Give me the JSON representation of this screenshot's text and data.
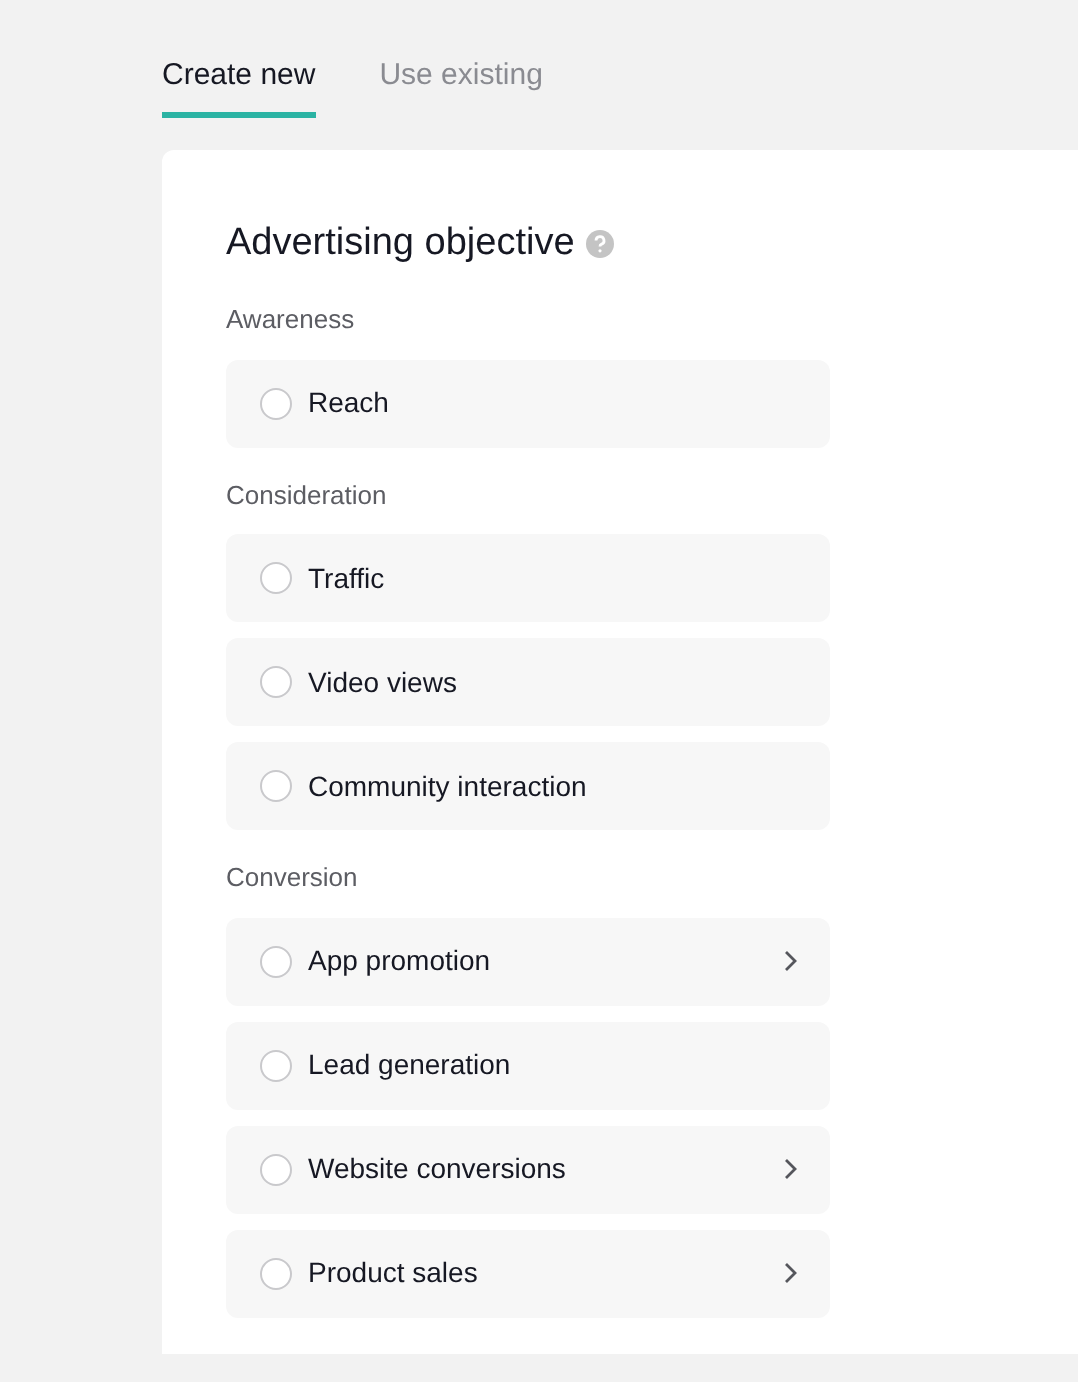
{
  "tabs": [
    {
      "label": "Create new",
      "selected": true
    },
    {
      "label": "Use existing",
      "selected": false
    }
  ],
  "panel": {
    "title": "Advertising objective",
    "help": true,
    "groups": [
      {
        "label": "Awareness",
        "options": [
          {
            "label": "Reach",
            "selected": false,
            "has_submenu": false
          }
        ]
      },
      {
        "label": "Consideration",
        "options": [
          {
            "label": "Traffic",
            "selected": false,
            "has_submenu": false
          },
          {
            "label": "Video views",
            "selected": false,
            "has_submenu": false
          },
          {
            "label": "Community interaction",
            "selected": false,
            "has_submenu": false
          }
        ]
      },
      {
        "label": "Conversion",
        "options": [
          {
            "label": "App promotion",
            "selected": false,
            "has_submenu": true
          },
          {
            "label": "Lead generation",
            "selected": false,
            "has_submenu": false
          },
          {
            "label": "Website conversions",
            "selected": false,
            "has_submenu": true
          },
          {
            "label": "Product sales",
            "selected": false,
            "has_submenu": true
          }
        ]
      }
    ]
  }
}
